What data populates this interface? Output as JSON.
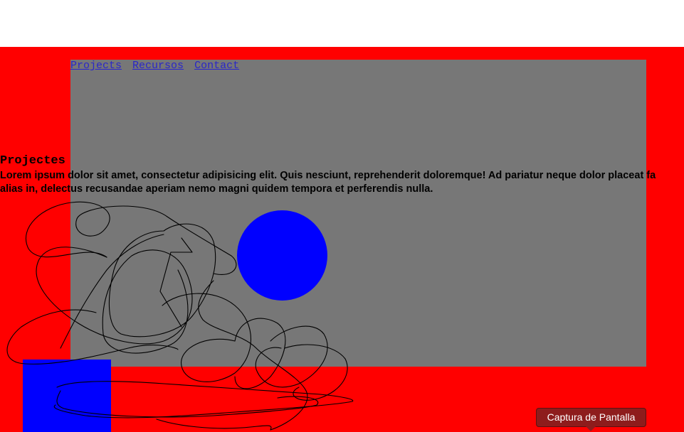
{
  "nav": {
    "links": [
      "Projects",
      "Recursos",
      "Contact"
    ]
  },
  "section": {
    "title": "Projectes",
    "body_line1": "Lorem ipsum dolor sit amet, consectetur adipisicing elit. Quis nesciunt, reprehenderit doloremque! Ad pariatur neque dolor placeat fa",
    "body_line2": "alias in, delectus recusandae aperiam nemo magni quidem tempora et perferendis nulla."
  },
  "capture_button": {
    "label": "Captura de Pantalla"
  },
  "colors": {
    "background": "#ff0000",
    "panel": "#777777",
    "shape": "#0000ff",
    "button": "#8e1c1c",
    "link": "#2a27c9"
  }
}
